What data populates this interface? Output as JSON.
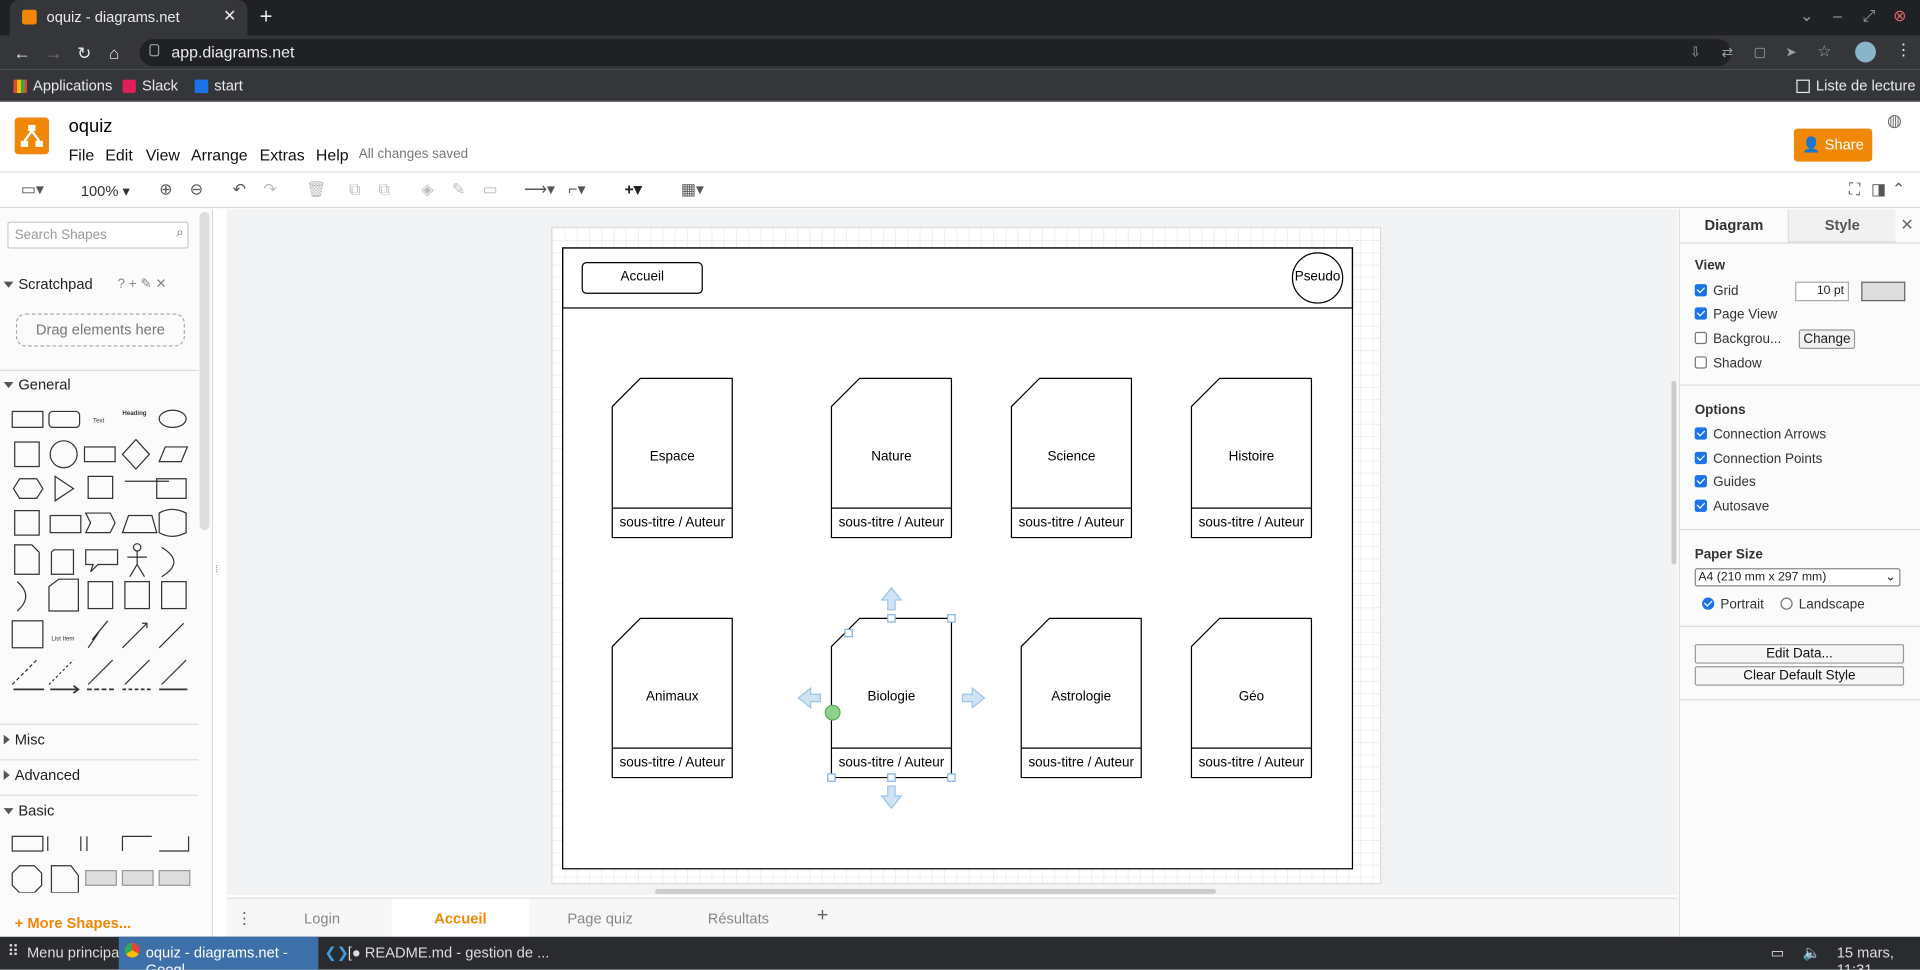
{
  "browser": {
    "tab_title": "oquiz - diagrams.net",
    "url": "app.diagrams.net",
    "bookmarks": [
      "Applications",
      "Slack",
      "start"
    ],
    "reading_list": "Liste de lecture"
  },
  "app": {
    "file_title": "oquiz",
    "menus": [
      "File",
      "Edit",
      "View",
      "Arrange",
      "Extras",
      "Help"
    ],
    "save_status": "All changes saved",
    "share_label": "Share"
  },
  "toolbar": {
    "zoom": "100%"
  },
  "left_panel": {
    "search_placeholder": "Search Shapes",
    "scratchpad": "Scratchpad",
    "scratchpad_hint": "Drag elements here",
    "sections": [
      "General",
      "Misc",
      "Advanced",
      "Basic"
    ],
    "more_shapes": "+ More Shapes..."
  },
  "diagram": {
    "home_button": "Accueil",
    "avatar": "Pseudo",
    "cards": [
      {
        "title": "Espace",
        "subtitle": "sous-titre / Auteur"
      },
      {
        "title": "Nature",
        "subtitle": "sous-titre / Auteur"
      },
      {
        "title": "Science",
        "subtitle": "sous-titre / Auteur"
      },
      {
        "title": "Histoire",
        "subtitle": "sous-titre / Auteur"
      },
      {
        "title": "Animaux",
        "subtitle": "sous-titre / Auteur"
      },
      {
        "title": "Biologie",
        "subtitle": "sous-titre / Auteur"
      },
      {
        "title": "Astrologie",
        "subtitle": "sous-titre / Auteur"
      },
      {
        "title": "Géo",
        "subtitle": "sous-titre / Auteur"
      }
    ]
  },
  "page_tabs": [
    "Login",
    "Accueil",
    "Page quiz",
    "Résultats"
  ],
  "active_page_tab": "Accueil",
  "right_panel": {
    "tabs": [
      "Diagram",
      "Style"
    ],
    "view_heading": "View",
    "grid_label": "Grid",
    "grid_size": "10 pt",
    "page_view_label": "Page View",
    "background_label": "Backgrou...",
    "change_label": "Change",
    "shadow_label": "Shadow",
    "options_heading": "Options",
    "options": [
      "Connection Arrows",
      "Connection Points",
      "Guides",
      "Autosave"
    ],
    "paper_heading": "Paper Size",
    "paper_value": "A4 (210 mm x 297 mm)",
    "portrait": "Portrait",
    "landscape": "Landscape",
    "edit_data": "Edit Data...",
    "clear_style": "Clear Default Style"
  },
  "taskbar": {
    "start": "Menu principal",
    "window1": "oquiz - diagrams.net - Googl...",
    "window2": "[● README.md - gestion de ...",
    "clock": "15 mars, 11:31"
  }
}
